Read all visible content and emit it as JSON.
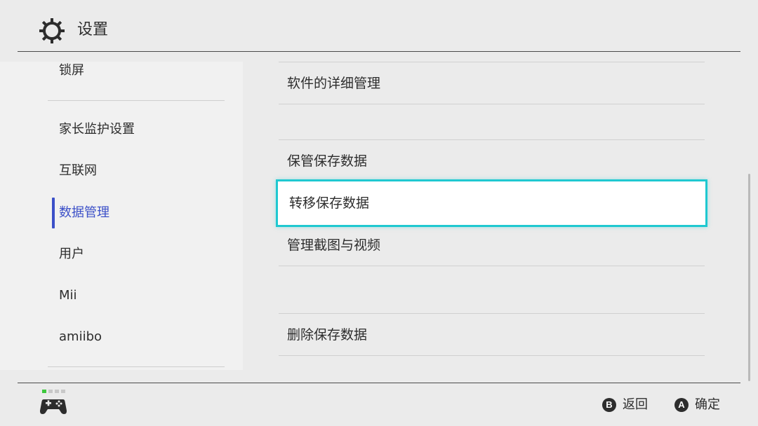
{
  "header": {
    "title": "设置",
    "icon": "gear-icon"
  },
  "sidebar": {
    "items": [
      {
        "label": "锁屏"
      },
      {
        "label": "家长监护设置"
      },
      {
        "label": "互联网"
      },
      {
        "label": "数据管理",
        "active": true
      },
      {
        "label": "用户"
      },
      {
        "label": "Mii"
      },
      {
        "label": "amiibo"
      }
    ]
  },
  "main": {
    "items": [
      {
        "label": "软件的详细管理"
      },
      {
        "label": "保管保存数据"
      },
      {
        "label": "转移保存数据",
        "selected": true
      },
      {
        "label": "管理截图与视频"
      },
      {
        "label": "删除保存数据"
      }
    ]
  },
  "footer": {
    "back": {
      "button": "B",
      "label": "返回"
    },
    "confirm": {
      "button": "A",
      "label": "确定"
    },
    "controller_icon": "controller-icon",
    "player_indicator_colors": [
      "#3cc83c",
      "#c8c8c8",
      "#c8c8c8",
      "#c8c8c8"
    ]
  },
  "colors": {
    "accent_selected_border": "#1fc8d0",
    "active_sidebar": "#3c50c8",
    "background": "#ebebeb",
    "sidebar_background": "#f1f1f1"
  }
}
